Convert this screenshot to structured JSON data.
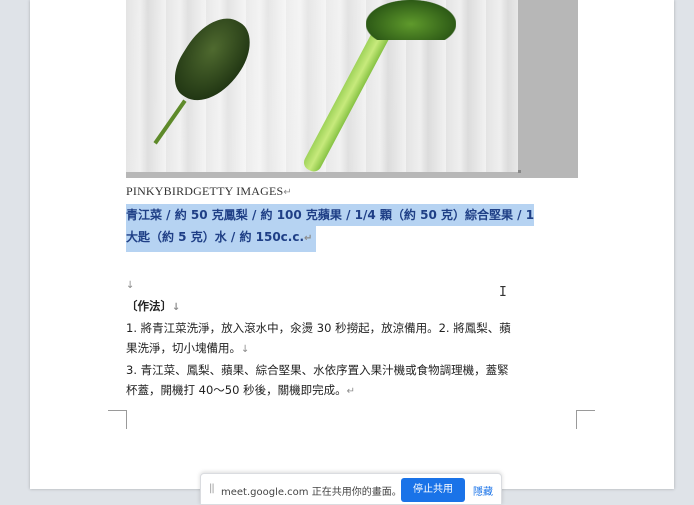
{
  "document": {
    "caption": "PINKYBIRDGETTY IMAGES",
    "caption_mark": "↵",
    "highlight_line1": "青江菜 / 約 50 克鳳梨 / 約 100 克蘋果 / 1/4 顆（約 50 克）綜合堅果 / 1",
    "highlight_line2": "大匙（約 5 克）水 / 約 150c.c.",
    "highlight_mark": "↵",
    "empty_mark": "↓",
    "method_heading": "〔作法〕",
    "method_mark": "↓",
    "step1_line1": "1. 將青江菜洗淨，放入滾水中，汆燙 30 秒撈起，放涼備用。2. 將鳳梨、蘋",
    "step1_line2": "果洗淨，切小塊備用。",
    "step1_mark": "↓",
    "step3_line1": "3. 青江菜、鳳梨、蘋果、綜合堅果、水依序置入果汁機或食物調理機，蓋緊",
    "step3_line2": "杯蓋，開機打 40～50 秒後，關機即完成。",
    "step3_mark": "↵"
  },
  "cursor": {
    "glyph": "I"
  },
  "share_bar": {
    "grip": "||",
    "message": "meet.google.com 正在共用你的畫面。",
    "stop_label": "停止共用",
    "hide_label": "隱藏"
  },
  "colors": {
    "highlight": "#b6d3f2",
    "highlight_text": "#1f3f86",
    "accent": "#1a73e8"
  }
}
